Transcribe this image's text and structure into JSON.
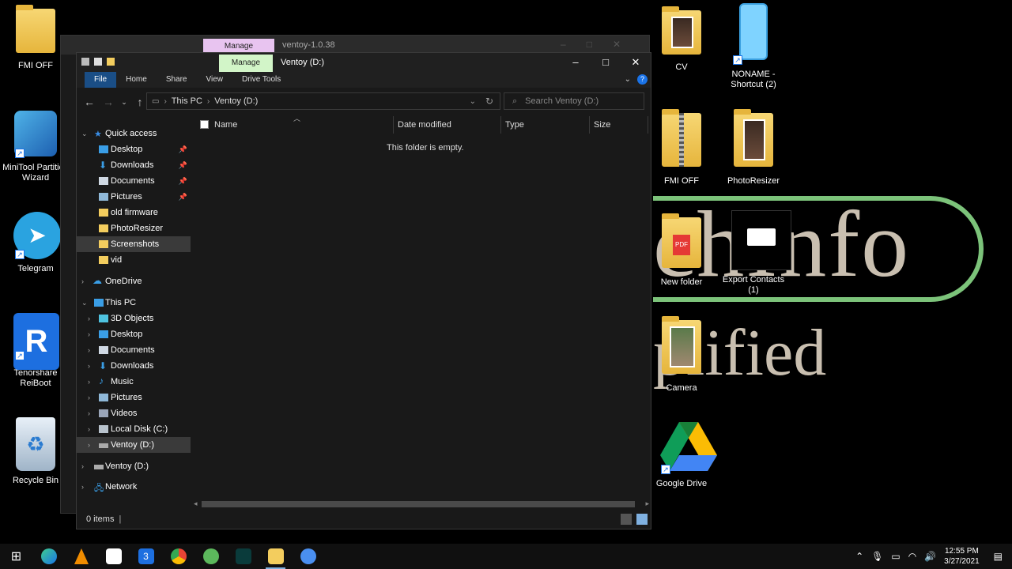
{
  "desktop": {
    "icons": [
      {
        "label": "FMI OFF"
      },
      {
        "label": "MiniTool Partition Wizard"
      },
      {
        "label": "Telegram"
      },
      {
        "label": "Tenorshare ReiBoot"
      },
      {
        "label": "Recycle Bin"
      },
      {
        "label": "CV"
      },
      {
        "label": "NONAME - Shortcut (2)"
      },
      {
        "label": "FMI OFF"
      },
      {
        "label": "PhotoResizer"
      },
      {
        "label": "New folder"
      },
      {
        "label": "Export Contacts (1)"
      },
      {
        "label": "Camera"
      },
      {
        "label": "Google Drive"
      }
    ],
    "bg_text_line1": "chInfo",
    "bg_text_line2": "plified"
  },
  "back_window": {
    "title": "ventoy-1.0.38",
    "manage_label": "Manage"
  },
  "window": {
    "title": "Ventoy (D:)",
    "manage_label": "Manage",
    "ribbon_tabs": [
      "File",
      "Home",
      "Share",
      "View",
      "Drive Tools"
    ],
    "address": {
      "crumbs": [
        "This PC",
        "Ventoy (D:)"
      ]
    },
    "search_placeholder": "Search Ventoy (D:)",
    "nav": {
      "quick_access": "Quick access",
      "quick_items": [
        "Desktop",
        "Downloads",
        "Documents",
        "Pictures",
        "old firmware",
        "PhotoResizer",
        "Screenshots",
        "vid"
      ],
      "onedrive": "OneDrive",
      "this_pc": "This PC",
      "pc_items": [
        "3D Objects",
        "Desktop",
        "Documents",
        "Downloads",
        "Music",
        "Pictures",
        "Videos",
        "Local Disk (C:)",
        "Ventoy (D:)"
      ],
      "ventoy": "Ventoy (D:)",
      "network": "Network"
    },
    "columns": [
      "Name",
      "Date modified",
      "Type",
      "Size"
    ],
    "empty_text": "This folder is empty.",
    "status": "0 items"
  },
  "taskbar": {
    "time": "12:55 PM",
    "date": "3/27/2021"
  },
  "colors": {
    "file_tab": "#1a4e86",
    "manage_front": "#d2f5c8",
    "manage_back": "#e8c4f0",
    "selection": "#3a3a3a",
    "accent": "#1a73e8"
  }
}
